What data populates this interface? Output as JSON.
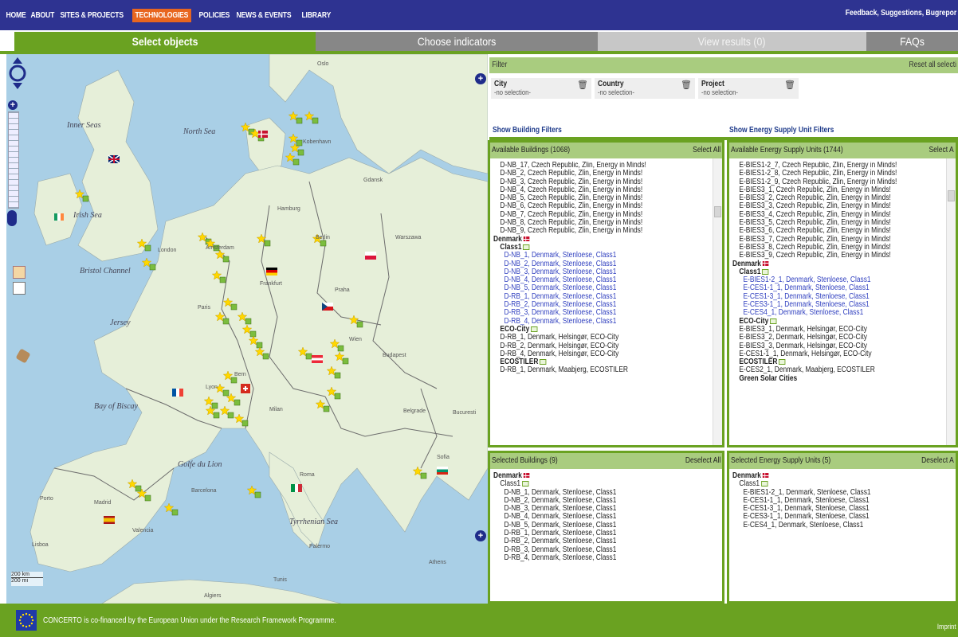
{
  "nav": {
    "items": [
      "HOME",
      "ABOUT",
      "SITES & PROJECTS",
      "TECHNOLOGIES",
      "POLICIES",
      "NEWS & EVENTS",
      "LIBRARY"
    ],
    "active_index": 3,
    "feedback": "Feedback, Suggestions, Bugrepor"
  },
  "tabs": {
    "select": "Select objects",
    "choose": "Choose indicators",
    "results": "View results (0)",
    "faqs": "FAQs"
  },
  "map": {
    "labels": [
      "North Sea",
      "Bay of Biscay",
      "Golfe du Lion",
      "Tyrrhenian Sea",
      "Inner Seas",
      "Irish Sea",
      "Bristol Channel",
      "Jersey",
      "Algiers",
      "Tunis",
      "Palermo",
      "Athens",
      "Barcelona",
      "Madrid",
      "Valencia",
      "Lisboa",
      "Porto",
      "Oslo",
      "Kobenhavn",
      "Amsterdam",
      "London",
      "Paris",
      "Berlin",
      "Praha",
      "Wien",
      "Bern",
      "Roma",
      "Sofia",
      "Budapest",
      "Warszawa",
      "Gdansk",
      "Hamburg",
      "Frankfurt",
      "Lyon",
      "Milan",
      "Belgrade",
      "Bucuresti"
    ],
    "scale_km": "200 km",
    "scale_mi": "200 mi"
  },
  "filter": {
    "title": "Filter",
    "reset": "Reset all selecti",
    "boxes": [
      {
        "label": "City",
        "value": "-no selection-"
      },
      {
        "label": "Country",
        "value": "-no selection-"
      },
      {
        "label": "Project",
        "value": "-no selection-"
      }
    ],
    "show_building": "Show Building Filters",
    "show_energy": "Show Energy Supply Unit Filters"
  },
  "available_buildings": {
    "title": "Available Buildings (1068)",
    "action": "Select All",
    "lines": [
      {
        "t": "D-NB_17, Czech Republic, Zlin, Energy in Minds!",
        "c": "indent1"
      },
      {
        "t": "D-NB_2, Czech Republic, Zlin, Energy in Minds!",
        "c": "indent1"
      },
      {
        "t": "D-NB_3, Czech Republic, Zlin, Energy in Minds!",
        "c": "indent1"
      },
      {
        "t": "D-NB_4, Czech Republic, Zlin, Energy in Minds!",
        "c": "indent1"
      },
      {
        "t": "D-NB_5, Czech Republic, Zlin, Energy in Minds!",
        "c": "indent1"
      },
      {
        "t": "D-NB_6, Czech Republic, Zlin, Energy in Minds!",
        "c": "indent1"
      },
      {
        "t": "D-NB_7, Czech Republic, Zlin, Energy in Minds!",
        "c": "indent1"
      },
      {
        "t": "D-NB_8, Czech Republic, Zlin, Energy in Minds!",
        "c": "indent1"
      },
      {
        "t": "D-NB_9, Czech Republic, Zlin, Energy in Minds!",
        "c": "indent1"
      },
      {
        "t": "Denmark",
        "c": "bold",
        "flag": true
      },
      {
        "t": "Class1",
        "c": "bold indent1",
        "proj": true
      },
      {
        "t": "D-NB_1, Denmark, Stenloese, Class1",
        "c": "indent2 blue"
      },
      {
        "t": "D-NB_2, Denmark, Stenloese, Class1",
        "c": "indent2 blue"
      },
      {
        "t": "D-NB_3, Denmark, Stenloese, Class1",
        "c": "indent2 blue"
      },
      {
        "t": "D-NB_4, Denmark, Stenloese, Class1",
        "c": "indent2 blue"
      },
      {
        "t": "D-NB_5, Denmark, Stenloese, Class1",
        "c": "indent2 blue"
      },
      {
        "t": "D-RB_1, Denmark, Stenloese, Class1",
        "c": "indent2 blue"
      },
      {
        "t": "D-RB_2, Denmark, Stenloese, Class1",
        "c": "indent2 blue"
      },
      {
        "t": "D-RB_3, Denmark, Stenloese, Class1",
        "c": "indent2 blue"
      },
      {
        "t": "D-RB_4, Denmark, Stenloese, Class1",
        "c": "indent2 blue"
      },
      {
        "t": "ECO-City",
        "c": "bold indent1",
        "proj": true
      },
      {
        "t": "D-RB_1, Denmark, Helsingør, ECO-City",
        "c": "indent1"
      },
      {
        "t": "D-RB_2, Denmark, Helsingør, ECO-City",
        "c": "indent1"
      },
      {
        "t": "D-RB_4, Denmark, Helsingør, ECO-City",
        "c": "indent1"
      },
      {
        "t": "ECOSTILER",
        "c": "bold indent1",
        "proj": true
      },
      {
        "t": "D-RB_1, Denmark, Maabjerg, ECOSTILER",
        "c": "indent1"
      }
    ]
  },
  "available_units": {
    "title": "Available Energy Supply Units (1744)",
    "action": "Select A",
    "lines": [
      {
        "t": "E-BIES1-2_7, Czech Republic, Zlin, Energy in Minds!",
        "c": "indent1"
      },
      {
        "t": "E-BIES1-2_8, Czech Republic, Zlin, Energy in Minds!",
        "c": "indent1"
      },
      {
        "t": "E-BIES1-2_9, Czech Republic, Zlin, Energy in Minds!",
        "c": "indent1"
      },
      {
        "t": "E-BIES3_1, Czech Republic, Zlin, Energy in Minds!",
        "c": "indent1"
      },
      {
        "t": "E-BIES3_2, Czech Republic, Zlin, Energy in Minds!",
        "c": "indent1"
      },
      {
        "t": "E-BIES3_3, Czech Republic, Zlin, Energy in Minds!",
        "c": "indent1"
      },
      {
        "t": "E-BIES3_4, Czech Republic, Zlin, Energy in Minds!",
        "c": "indent1"
      },
      {
        "t": "E-BIES3_5, Czech Republic, Zlin, Energy in Minds!",
        "c": "indent1"
      },
      {
        "t": "E-BIES3_6, Czech Republic, Zlin, Energy in Minds!",
        "c": "indent1"
      },
      {
        "t": "E-BIES3_7, Czech Republic, Zlin, Energy in Minds!",
        "c": "indent1"
      },
      {
        "t": "E-BIES3_8, Czech Republic, Zlin, Energy in Minds!",
        "c": "indent1"
      },
      {
        "t": "E-BIES3_9, Czech Republic, Zlin, Energy in Minds!",
        "c": "indent1"
      },
      {
        "t": "Denmark",
        "c": "bold",
        "flag": true
      },
      {
        "t": "Class1",
        "c": "bold indent1",
        "proj": true
      },
      {
        "t": "E-BIES1-2_1, Denmark, Stenloese, Class1",
        "c": "indent2 blue"
      },
      {
        "t": "E-CES1-1_1, Denmark, Stenloese, Class1",
        "c": "indent2 blue"
      },
      {
        "t": "E-CES1-3_1, Denmark, Stenloese, Class1",
        "c": "indent2 blue"
      },
      {
        "t": "E-CES3-1_1, Denmark, Stenloese, Class1",
        "c": "indent2 blue"
      },
      {
        "t": "E-CES4_1, Denmark, Stenloese, Class1",
        "c": "indent2 blue"
      },
      {
        "t": "ECO-City",
        "c": "bold indent1",
        "proj": true
      },
      {
        "t": "E-BIES3_1, Denmark, Helsingør, ECO-City",
        "c": "indent1"
      },
      {
        "t": "E-BIES3_2, Denmark, Helsingør, ECO-City",
        "c": "indent1"
      },
      {
        "t": "E-BIES3_3, Denmark, Helsingør, ECO-City",
        "c": "indent1"
      },
      {
        "t": "E-CES1-1_1, Denmark, Helsingør, ECO-City",
        "c": "indent1"
      },
      {
        "t": "ECOSTILER",
        "c": "bold indent1",
        "proj": true
      },
      {
        "t": "E-CES2_1, Denmark, Maabjerg, ECOSTILER",
        "c": "indent1"
      },
      {
        "t": "Green Solar Cities",
        "c": "bold indent1"
      }
    ]
  },
  "selected_buildings": {
    "title": "Selected Buildings (9)",
    "action": "Deselect All",
    "lines": [
      {
        "t": "Denmark",
        "c": "bold",
        "flag": true
      },
      {
        "t": "Class1",
        "c": "indent1",
        "proj": true
      },
      {
        "t": "D-NB_1, Denmark, Stenloese, Class1",
        "c": "indent2"
      },
      {
        "t": "D-NB_2, Denmark, Stenloese, Class1",
        "c": "indent2"
      },
      {
        "t": "D-NB_3, Denmark, Stenloese, Class1",
        "c": "indent2"
      },
      {
        "t": "D-NB_4, Denmark, Stenloese, Class1",
        "c": "indent2"
      },
      {
        "t": "D-NB_5, Denmark, Stenloese, Class1",
        "c": "indent2"
      },
      {
        "t": "D-RB_1, Denmark, Stenloese, Class1",
        "c": "indent2"
      },
      {
        "t": "D-RB_2, Denmark, Stenloese, Class1",
        "c": "indent2"
      },
      {
        "t": "D-RB_3, Denmark, Stenloese, Class1",
        "c": "indent2"
      },
      {
        "t": "D-RB_4, Denmark, Stenloese, Class1",
        "c": "indent2"
      }
    ]
  },
  "selected_units": {
    "title": "Selected Energy Supply Units (5)",
    "action": "Deselect A",
    "lines": [
      {
        "t": "Denmark",
        "c": "bold",
        "flag": true
      },
      {
        "t": "Class1",
        "c": "indent1",
        "proj": true
      },
      {
        "t": "E-BIES1-2_1, Denmark, Stenloese, Class1",
        "c": "indent2"
      },
      {
        "t": "E-CES1-1_1, Denmark, Stenloese, Class1",
        "c": "indent2"
      },
      {
        "t": "E-CES1-3_1, Denmark, Stenloese, Class1",
        "c": "indent2"
      },
      {
        "t": "E-CES3-1_1, Denmark, Stenloese, Class1",
        "c": "indent2"
      },
      {
        "t": "E-CES4_1, Denmark, Stenloese, Class1",
        "c": "indent2"
      }
    ]
  },
  "footer": {
    "text": "CONCERTO is co-financed by the European Union under the Research Framework Programme.",
    "imprint": "Imprint"
  },
  "colors": {
    "nav": "#2e3391",
    "accent": "#6aa221",
    "active": "#e8661f",
    "link": "#2f3fbf"
  }
}
